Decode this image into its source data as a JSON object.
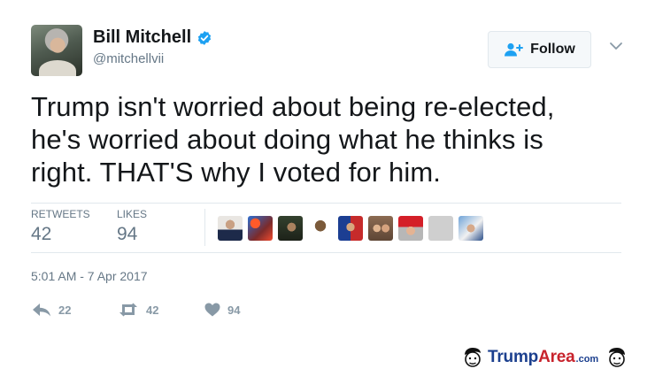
{
  "user": {
    "name": "Bill Mitchell",
    "handle": "@mitchellvii",
    "verified": true
  },
  "follow_button": {
    "label": "Follow"
  },
  "tweet": {
    "text_lines": [
      "Trump isn't worried about being re-elected,",
      "he's worried about doing what he thinks is",
      "right.  THAT'S why I voted for him."
    ],
    "timestamp": "5:01 AM - 7 Apr 2017"
  },
  "stats": {
    "retweets_label": "RETWEETS",
    "retweets_count": "42",
    "likes_label": "LIKES",
    "likes_count": "94"
  },
  "actions": {
    "reply_count": "22",
    "retweet_count": "42",
    "like_count": "94"
  },
  "watermark": {
    "brand_blue": "Trump",
    "brand_red": "Area",
    "suffix": ".com"
  },
  "colors": {
    "text": "#14171a",
    "secondary": "#657786",
    "verified": "#1da1f2",
    "divider": "#e1e8ed",
    "action_gray": "#8899a6",
    "brand_blue": "#1b3f8e",
    "brand_red": "#c8232c"
  }
}
